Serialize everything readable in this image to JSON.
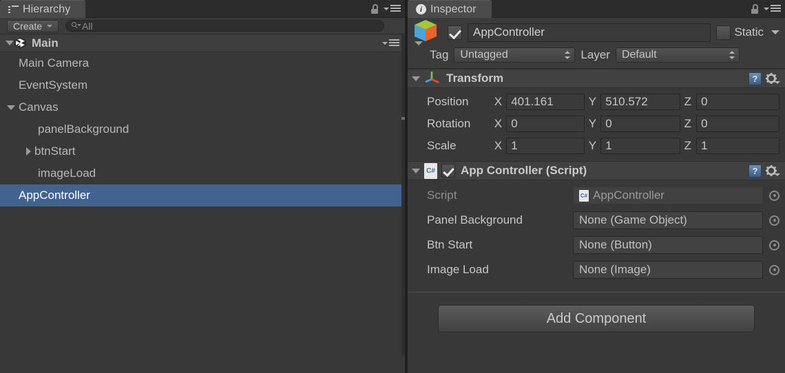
{
  "hierarchy": {
    "tab": {
      "title": "Hierarchy",
      "icon": "hierarchy-list-icon"
    },
    "toolbar": {
      "create_label": "Create",
      "search_placeholder": "All",
      "search_value": ""
    },
    "scene": {
      "name": "Main",
      "icon": "unity-scene-icon",
      "expanded": true
    },
    "items": [
      {
        "label": "Main Camera",
        "indent": 1,
        "foldout": "none",
        "selected": false
      },
      {
        "label": "EventSystem",
        "indent": 1,
        "foldout": "none",
        "selected": false
      },
      {
        "label": "Canvas",
        "indent": 1,
        "foldout": "open",
        "selected": false
      },
      {
        "label": "panelBackground",
        "indent": 2,
        "foldout": "none",
        "selected": false
      },
      {
        "label": "btnStart",
        "indent": 2,
        "foldout": "closed",
        "selected": false
      },
      {
        "label": "imageLoad",
        "indent": 2,
        "foldout": "none",
        "selected": false
      },
      {
        "label": "AppController",
        "indent": 1,
        "foldout": "none",
        "selected": true
      }
    ]
  },
  "inspector": {
    "tab": {
      "title": "Inspector",
      "icon": "info-icon"
    },
    "gameobject": {
      "enabled": true,
      "name": "AppController",
      "name_placeholder": "Name",
      "static_label": "Static",
      "static_checked": false,
      "tag_label": "Tag",
      "tag_value": "Untagged",
      "layer_label": "Layer",
      "layer_value": "Default"
    },
    "transform": {
      "title": "Transform",
      "expanded": true,
      "rows": [
        {
          "label": "Position",
          "x": "401.161",
          "y": "510.572",
          "z": "0"
        },
        {
          "label": "Rotation",
          "x": "0",
          "y": "0",
          "z": "0"
        },
        {
          "label": "Scale",
          "x": "1",
          "y": "1",
          "z": "1"
        }
      ],
      "axis_labels": {
        "x": "X",
        "y": "Y",
        "z": "Z"
      }
    },
    "script_component": {
      "title": "App Controller (Script)",
      "enabled": true,
      "expanded": true,
      "properties": [
        {
          "label": "Script",
          "value": "AppController",
          "dim": true,
          "has_icon": true
        },
        {
          "label": "Panel Background",
          "value": "None (Game Object)",
          "dim": false,
          "has_icon": false
        },
        {
          "label": "Btn Start",
          "value": "None (Button)",
          "dim": false,
          "has_icon": false
        },
        {
          "label": "Image Load",
          "value": "None (Image)",
          "dim": false,
          "has_icon": false
        }
      ]
    },
    "add_component_label": "Add Component"
  },
  "colors": {
    "panel_bg": "#383838",
    "selection_blue": "#42628f",
    "tab_active": "#4b4b4b",
    "text": "#c6c6c6",
    "text_dim": "#8e8e8e"
  }
}
